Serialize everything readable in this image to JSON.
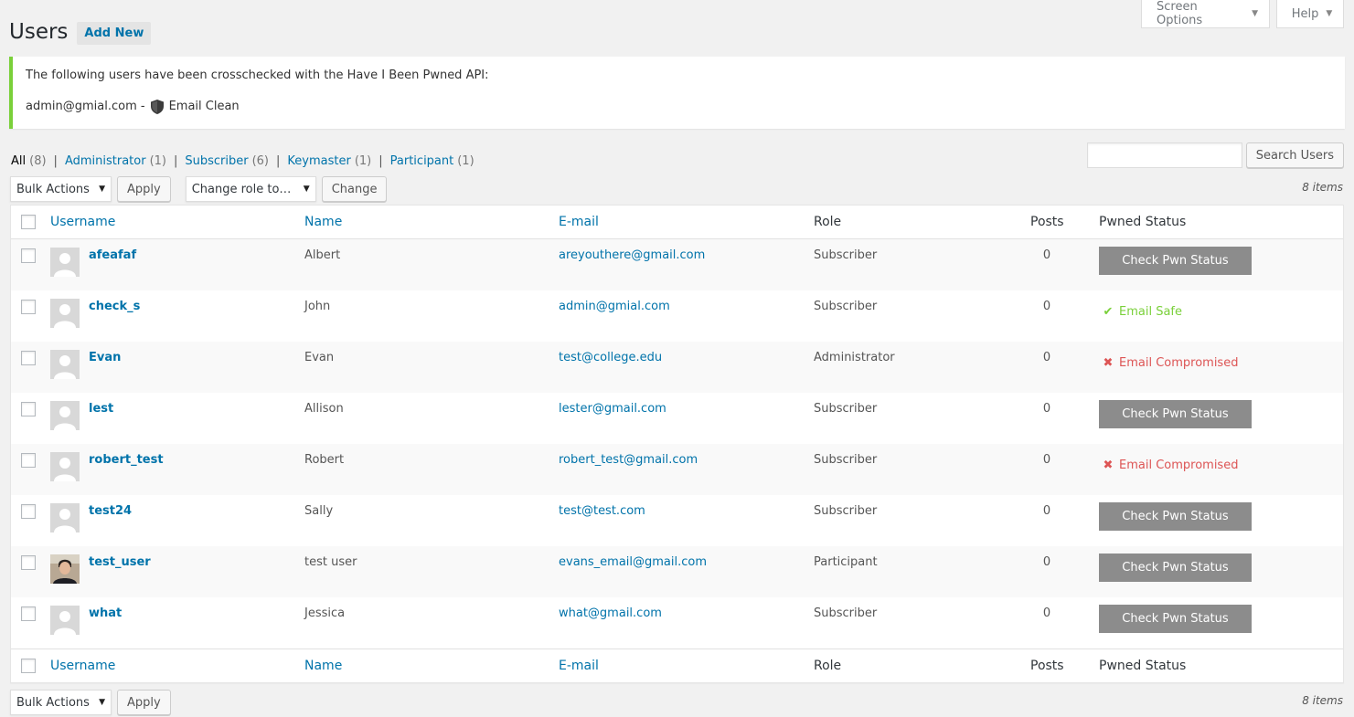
{
  "meta_tabs": {
    "screen_options": "Screen Options",
    "help": "Help"
  },
  "header": {
    "title": "Users",
    "add_new": "Add New"
  },
  "notice": {
    "message": "The following users have been crosschecked with the Have I Been Pwned API:",
    "email": "admin@gmial.com -",
    "status": "Email Clean"
  },
  "filters": [
    {
      "label": "All",
      "count": "(8)"
    },
    {
      "label": "Administrator",
      "count": "(1)"
    },
    {
      "label": "Subscriber",
      "count": "(6)"
    },
    {
      "label": "Keymaster",
      "count": "(1)"
    },
    {
      "label": "Participant",
      "count": "(1)"
    }
  ],
  "search": {
    "button": "Search Users",
    "value": ""
  },
  "tablenav": {
    "bulk_actions": "Bulk Actions",
    "apply": "Apply",
    "change_role": "Change role to…",
    "change": "Change",
    "items": "8 items"
  },
  "columns": {
    "username": "Username",
    "name": "Name",
    "email": "E-mail",
    "role": "Role",
    "posts": "Posts",
    "pwned": "Pwned Status"
  },
  "users": [
    {
      "username": "afeafaf",
      "name": "Albert",
      "email": "areyouthere@gmail.com",
      "role": "Subscriber",
      "posts": "0",
      "status_type": "button",
      "status": "Check Pwn Status",
      "avatar": "default"
    },
    {
      "username": "check_s",
      "name": "John",
      "email": "admin@gmial.com",
      "role": "Subscriber",
      "posts": "0",
      "status_type": "safe",
      "status": "Email Safe",
      "avatar": "default"
    },
    {
      "username": "Evan",
      "name": "Evan",
      "email": "test@college.edu",
      "role": "Administrator",
      "posts": "0",
      "status_type": "bad",
      "status": "Email Compromised",
      "avatar": "default"
    },
    {
      "username": "lest",
      "name": "Allison",
      "email": "lester@gmail.com",
      "role": "Subscriber",
      "posts": "0",
      "status_type": "button",
      "status": "Check Pwn Status",
      "avatar": "default"
    },
    {
      "username": "robert_test",
      "name": "Robert",
      "email": "robert_test@gmail.com",
      "role": "Subscriber",
      "posts": "0",
      "status_type": "bad",
      "status": "Email Compromised",
      "avatar": "default"
    },
    {
      "username": "test24",
      "name": "Sally",
      "email": "test@test.com",
      "role": "Subscriber",
      "posts": "0",
      "status_type": "button",
      "status": "Check Pwn Status",
      "avatar": "default"
    },
    {
      "username": "test_user",
      "name": "test user",
      "email": "evans_email@gmail.com",
      "role": "Participant",
      "posts": "0",
      "status_type": "button",
      "status": "Check Pwn Status",
      "avatar": "photo"
    },
    {
      "username": "what",
      "name": "Jessica",
      "email": "what@gmail.com",
      "role": "Subscriber",
      "posts": "0",
      "status_type": "button",
      "status": "Check Pwn Status",
      "avatar": "default"
    }
  ],
  "colors": {
    "accent": "#0073aa",
    "notice_border": "#7ad03a",
    "safe": "#7ad03a",
    "compromised": "#dd5555",
    "pwn_button": "#8c8c8c"
  }
}
